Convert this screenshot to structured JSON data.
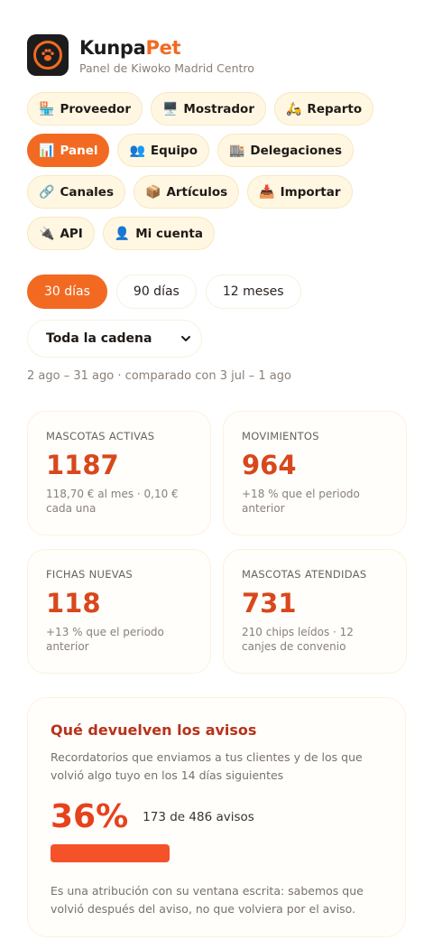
{
  "brand": {
    "name_main": "Kunpa",
    "name_accent": "Pet",
    "subtitle": "Panel de Kiwoko Madrid Centro",
    "accent_color": "#f26a21"
  },
  "nav": [
    {
      "icon": "🏪",
      "icon_name": "store-icon",
      "label": "Proveedor",
      "active": false
    },
    {
      "icon": "🖥️",
      "icon_name": "monitor-icon",
      "label": "Mostrador",
      "active": false
    },
    {
      "icon": "🛵",
      "icon_name": "scooter-icon",
      "label": "Reparto",
      "active": false
    },
    {
      "icon": "📊",
      "icon_name": "bar-chart-icon",
      "label": "Panel",
      "active": true
    },
    {
      "icon": "👥",
      "icon_name": "people-icon",
      "label": "Equipo",
      "active": false
    },
    {
      "icon": "🏬",
      "icon_name": "building-icon",
      "label": "Delegaciones",
      "active": false
    },
    {
      "icon": "🔗",
      "icon_name": "link-icon",
      "label": "Canales",
      "active": false
    },
    {
      "icon": "📦",
      "icon_name": "package-icon",
      "label": "Artículos",
      "active": false
    },
    {
      "icon": "📥",
      "icon_name": "inbox-tray-icon",
      "label": "Importar",
      "active": false
    },
    {
      "icon": "🔌",
      "icon_name": "plug-icon",
      "label": "API",
      "active": false
    },
    {
      "icon": "👤",
      "icon_name": "user-icon",
      "label": "Mi cuenta",
      "active": false
    }
  ],
  "ranges": [
    {
      "label": "30 días",
      "active": true
    },
    {
      "label": "90 días",
      "active": false
    },
    {
      "label": "12 meses",
      "active": false
    }
  ],
  "scope": {
    "selected": "Toda la cadena"
  },
  "date_range": "2 ago – 31 ago · comparado con 3 jul – 1 ago",
  "stats": [
    {
      "label": "MASCOTAS ACTIVAS",
      "value": "1187",
      "sub": "118,70 € al mes · 0,10 € cada una"
    },
    {
      "label": "MOVIMIENTOS",
      "value": "964",
      "sub": "+18 % que el periodo anterior"
    },
    {
      "label": "FICHAS NUEVAS",
      "value": "118",
      "sub": "+13 % que el periodo anterior"
    },
    {
      "label": "MASCOTAS ATENDIDAS",
      "value": "731",
      "sub": "210 chips leídos · 12 canjes de convenio"
    }
  ],
  "reminders": {
    "title": "Qué devuelven los avisos",
    "description": "Recordatorios que enviamos a tus clientes y de los que volvió algo tuyo en los 14 días siguientes",
    "percent_text": "36%",
    "count_text": "173 de 486 avisos",
    "progress_fraction": 0.36,
    "note": "Es una atribución con su ventana escrita: sabemos que volvió después del aviso, no que volviera por el aviso."
  }
}
